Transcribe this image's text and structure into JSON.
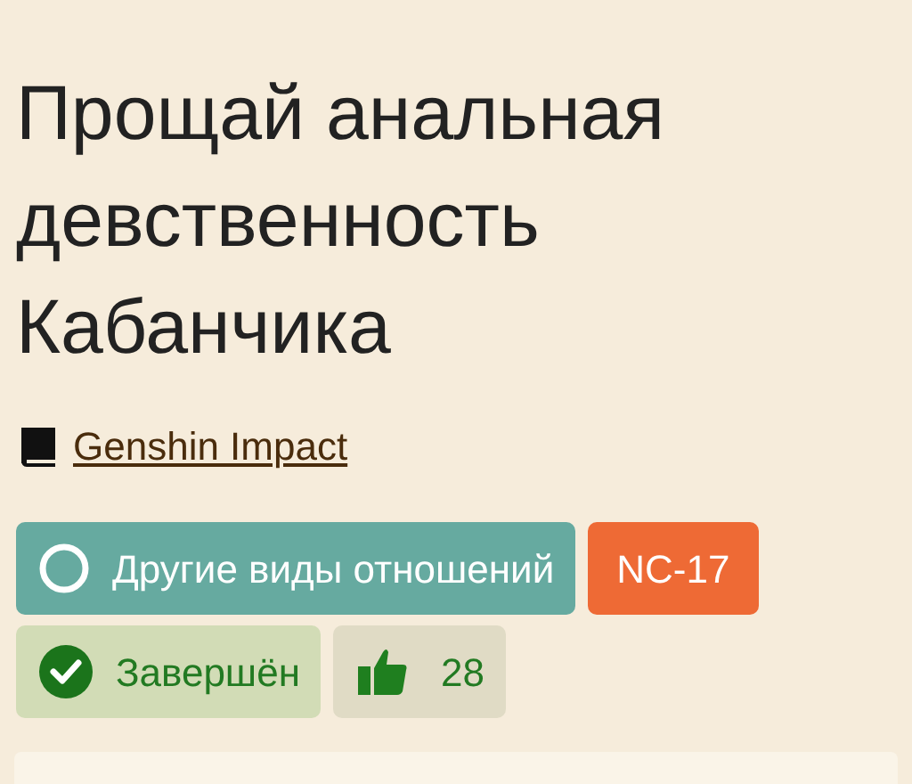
{
  "title": "Прощай анальная девственность Кабанчика",
  "fandom": {
    "label": "Genshin Impact"
  },
  "badges": [
    {
      "kind": "direction",
      "label": "Другие виды отношений"
    },
    {
      "kind": "rating",
      "label": "NC-17"
    },
    {
      "kind": "status",
      "label": "Завершён",
      "completed": true
    },
    {
      "kind": "likes",
      "label": "28"
    }
  ]
}
